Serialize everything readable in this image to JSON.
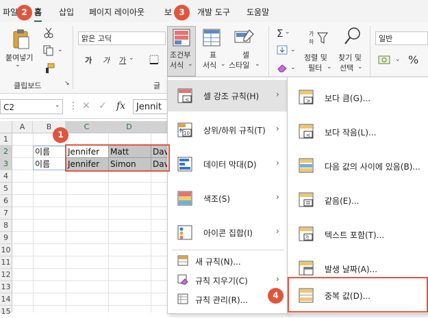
{
  "menubar": {
    "tabs": [
      "파일",
      "홈",
      "삽입",
      "페이지 레이아웃",
      "보",
      "개발 도구",
      "도움말"
    ]
  },
  "callouts": [
    "1",
    "2",
    "3",
    "4"
  ],
  "ribbon": {
    "paste_label": "붙여넣기",
    "clipboard_group": "클립보드",
    "font_name": "맑은 고딕",
    "bold": "가",
    "italic": "가",
    "underline": "가",
    "font_group": "글",
    "cond_format_line1": "조건부",
    "cond_format_line2": "서식",
    "table_line1": "표",
    "table_line2": "서식",
    "cell_style_line1": "셀",
    "cell_style_line2": "스타일",
    "sort_line1": "정렬 및",
    "sort_line2": "필터",
    "find_line1": "찾기 및",
    "find_line2": "선택",
    "number_format": "일반",
    "percent": "%"
  },
  "formula_bar": {
    "name_box": "C2",
    "fx": "fx",
    "content": "Jennit"
  },
  "grid": {
    "columns": [
      "A",
      "B",
      "C",
      "D"
    ],
    "rows": [
      "1",
      "2",
      "3",
      "4",
      "5",
      "6",
      "7",
      "8",
      "9",
      "10",
      "11",
      "12",
      "13",
      "14",
      "15"
    ],
    "cells": {
      "B2": "이름",
      "C2": "Jennifer",
      "D2": "Matt",
      "E2": "Dav",
      "B3": "이름",
      "C3": "Jennifer",
      "D3": "Simon",
      "E3": "Dav"
    }
  },
  "menu": {
    "items": [
      {
        "label": "셀 강조 규칙(H)",
        "icon": "highlight-cells-icon",
        "has_sub": true
      },
      {
        "label": "상위/하위 규칙(T)",
        "icon": "top-bottom-icon",
        "has_sub": true
      },
      {
        "label": "데이터 막대(D)",
        "icon": "data-bars-icon",
        "has_sub": true
      },
      {
        "label": "색조(S)",
        "icon": "color-scales-icon",
        "has_sub": true
      },
      {
        "label": "아이콘 집합(I)",
        "icon": "icon-sets-icon",
        "has_sub": true
      },
      {
        "label": "새 규칙(N)...",
        "icon": "new-rule-icon",
        "has_sub": false
      },
      {
        "label": "규칙 지우기(C)",
        "icon": "clear-rules-icon",
        "has_sub": true
      },
      {
        "label": "규칙 관리(R)...",
        "icon": "manage-rules-icon",
        "has_sub": false
      }
    ]
  },
  "submenu": {
    "items": [
      {
        "label": "보다 큼(G)...",
        "icon": "greater-than-icon"
      },
      {
        "label": "보다 작음(L)...",
        "icon": "less-than-icon"
      },
      {
        "label": "다음 값의 사이에 있음(B)...",
        "icon": "between-icon"
      },
      {
        "label": "같음(E)...",
        "icon": "equal-to-icon"
      },
      {
        "label": "텍스트 포함(T)...",
        "icon": "text-contains-icon"
      },
      {
        "label": "발생 날짜(A)...",
        "icon": "date-occurring-icon"
      },
      {
        "label": "중복 값(D)...",
        "icon": "duplicate-values-icon"
      }
    ]
  },
  "colors": {
    "accent_red": "#e1553d",
    "excel_green": "#217346",
    "selection_fill": "#c6c6c6"
  }
}
